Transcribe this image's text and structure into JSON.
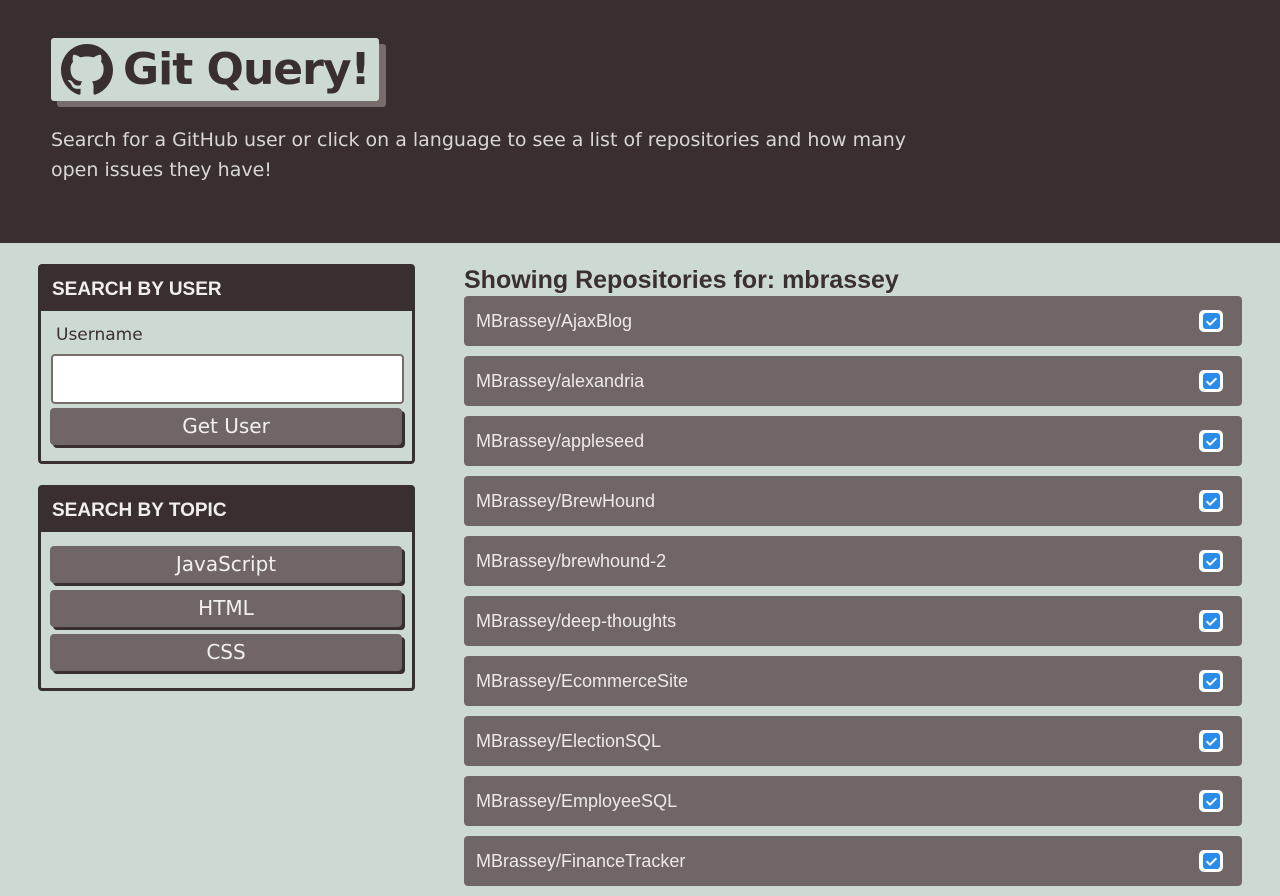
{
  "header": {
    "title": "Git Query!",
    "subtitle": "Search for a GitHub user or click on a language to see a list of repositories and how many open issues they have!",
    "logo_icon": "github-icon"
  },
  "user_search": {
    "heading": "SEARCH BY USER",
    "username_label": "Username",
    "username_value": "",
    "button_label": "Get User"
  },
  "topic_search": {
    "heading": "SEARCH BY TOPIC",
    "topics": [
      {
        "label": "JavaScript"
      },
      {
        "label": "HTML"
      },
      {
        "label": "CSS"
      }
    ]
  },
  "results": {
    "title": "Showing Repositories for: mbrassey",
    "status_icon": "check-square-icon",
    "repos": [
      {
        "name": "MBrassey/AjaxBlog"
      },
      {
        "name": "MBrassey/alexandria"
      },
      {
        "name": "MBrassey/appleseed"
      },
      {
        "name": "MBrassey/BrewHound"
      },
      {
        "name": "MBrassey/brewhound-2"
      },
      {
        "name": "MBrassey/deep-thoughts"
      },
      {
        "name": "MBrassey/EcommerceSite"
      },
      {
        "name": "MBrassey/ElectionSQL"
      },
      {
        "name": "MBrassey/EmployeeSQL"
      },
      {
        "name": "MBrassey/FinanceTracker"
      }
    ]
  },
  "colors": {
    "header_bg": "#3a2f2f",
    "page_bg": "#cddad2",
    "item_bg": "#6f6665",
    "check_blue": "#2a8be8"
  }
}
